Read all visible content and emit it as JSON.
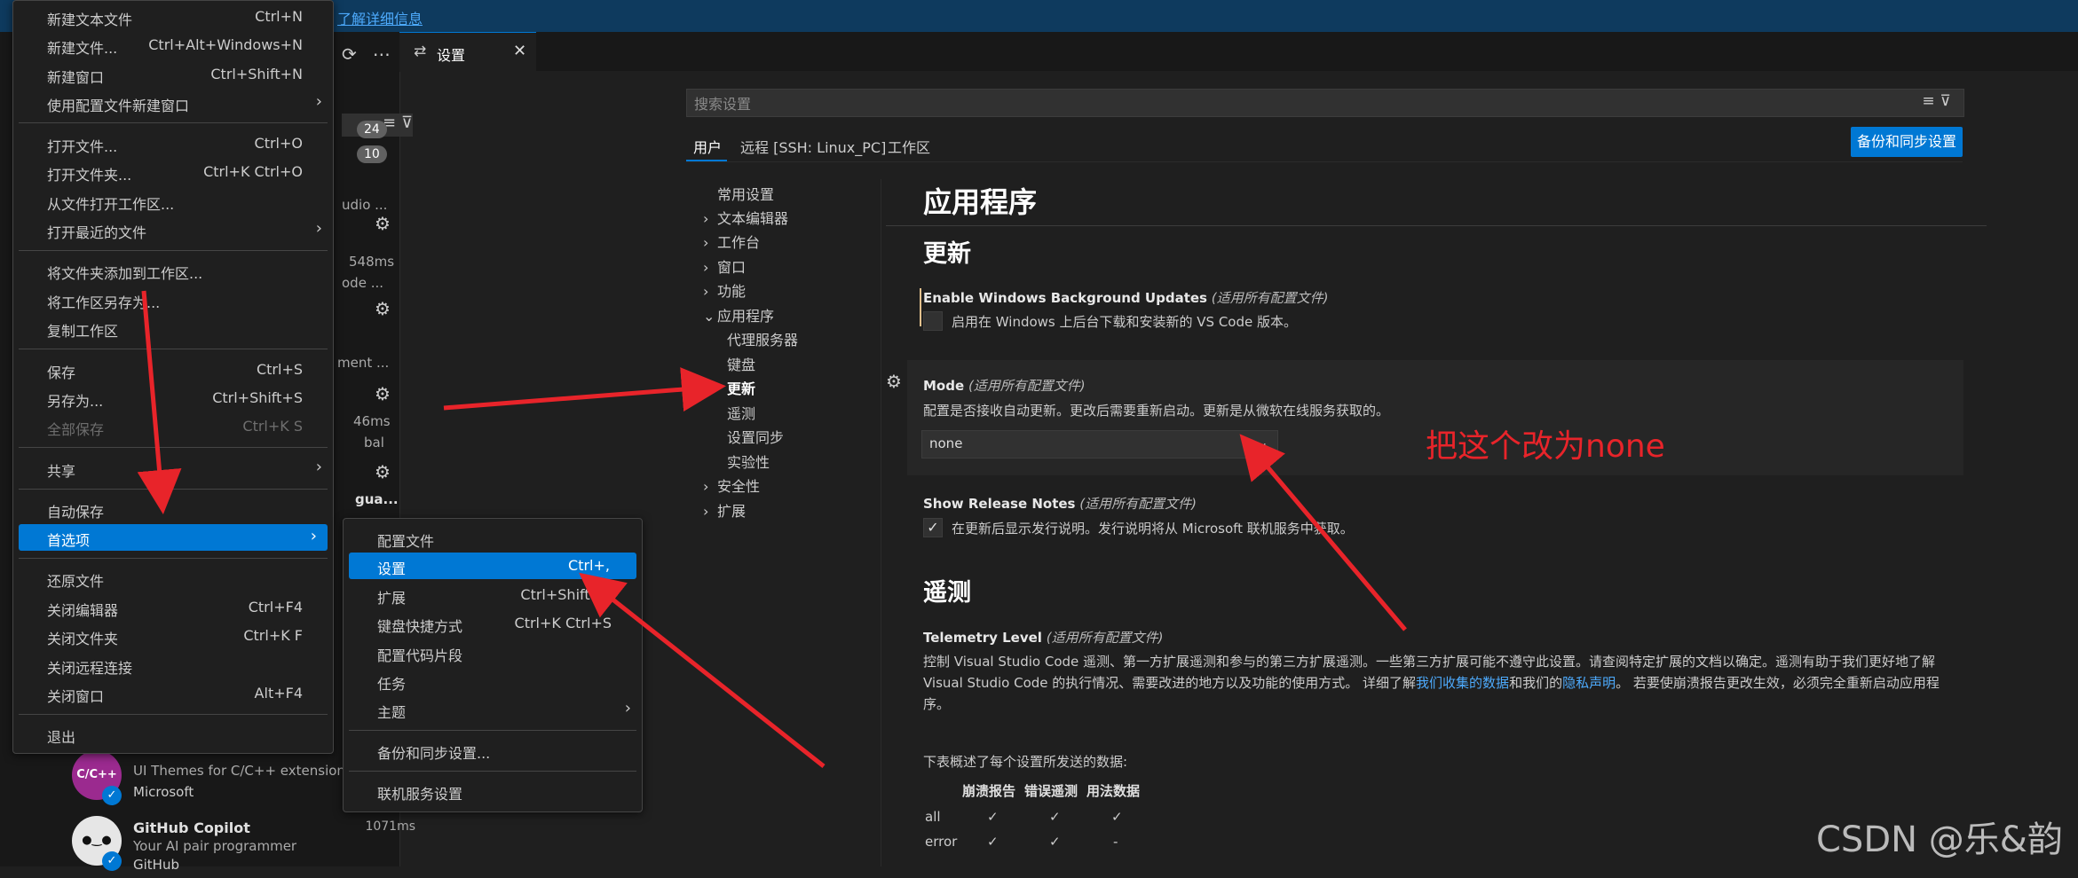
{
  "notice": {
    "link_text": "了解详细信息"
  },
  "tab": {
    "label": "设置"
  },
  "sidebar": {
    "badges": [
      "24",
      "10"
    ],
    "fragments": [
      "udio ...",
      "548ms",
      "ode ...",
      "ment ...",
      "46ms",
      "bal",
      "gua..."
    ],
    "extensions": [
      {
        "icon": "C/C++",
        "name": "",
        "desc": "UI Themes for C/C++ extension.",
        "publisher": "Microsoft",
        "time": ""
      },
      {
        "icon": "Copilot",
        "name": "GitHub Copilot",
        "desc": "Your AI pair programmer",
        "publisher": "GitHub",
        "time": "1071ms",
        "status": "已启用"
      }
    ]
  },
  "settings": {
    "search_placeholder": "搜索设置",
    "tabs": [
      "用户",
      "远程 [SSH: Linux_PC]",
      "工作区"
    ],
    "sync_button": "备份和同步设置",
    "toc": [
      {
        "label": "常用设置",
        "chevron": ""
      },
      {
        "label": "文本编辑器",
        "chevron": "›"
      },
      {
        "label": "工作台",
        "chevron": "›"
      },
      {
        "label": "窗口",
        "chevron": "›"
      },
      {
        "label": "功能",
        "chevron": "›"
      },
      {
        "label": "应用程序",
        "chevron": "⌄"
      },
      {
        "label": "代理服务器",
        "chevron": ""
      },
      {
        "label": "键盘",
        "chevron": ""
      },
      {
        "label": "更新",
        "chevron": ""
      },
      {
        "label": "遥测",
        "chevron": ""
      },
      {
        "label": "设置同步",
        "chevron": ""
      },
      {
        "label": "实验性",
        "chevron": ""
      },
      {
        "label": "安全性",
        "chevron": "›"
      },
      {
        "label": "扩展",
        "chevron": "›"
      }
    ],
    "h1": "应用程序",
    "section_update": "更新",
    "bg_updates": {
      "title": "Enable Windows Background Updates",
      "scope": "(适用所有配置文件)",
      "desc": "启用在 Windows 上后台下载和安装新的 VS Code 版本。",
      "checked": false
    },
    "mode": {
      "title": "Mode",
      "scope": "(适用所有配置文件)",
      "desc": "配置是否接收自动更新。更改后需要重新启动。更新是从微软在线服务获取的。",
      "value": "none"
    },
    "release_notes": {
      "title": "Show Release Notes",
      "scope": "(适用所有配置文件)",
      "desc": "在更新后显示发行说明。发行说明将从 Microsoft 联机服务中获取。",
      "checked": true
    },
    "section_telemetry": "遥测",
    "telemetry": {
      "title": "Telemetry Level",
      "scope": "(适用所有配置文件)",
      "desc1": "控制 Visual Studio Code 遥测、第一方扩展遥测和参与的第三方扩展遥测。一些第三方扩展可能不遵守此设置。请查阅特定扩展的文档以确定。遥测有助于我们更好地了解 Visual Studio Code 的执行情况、需要改进的地方以及功能的使用方式。 详细了解",
      "link1": "我们收集的数据",
      "mid": "和我们的",
      "link2": "隐私声明",
      "desc2": "。 若要使崩溃报告更改生效，必须完全重新启动应用程序。",
      "table_intro": "下表概述了每个设置所发送的数据:",
      "table_headers": [
        "崩溃报告",
        "错误遥测",
        "用法数据"
      ],
      "table_rows": [
        {
          "level": "all",
          "cells": [
            "✓",
            "✓",
            "✓"
          ]
        },
        {
          "level": "error",
          "cells": [
            "✓",
            "✓",
            "-"
          ]
        }
      ]
    }
  },
  "annotation": "把这个改为none",
  "watermark": "CSDN @乐&韵",
  "file_menu": [
    {
      "label": "新建文本文件",
      "key": "Ctrl+N"
    },
    {
      "label": "新建文件...",
      "key": "Ctrl+Alt+Windows+N"
    },
    {
      "label": "新建窗口",
      "key": "Ctrl+Shift+N"
    },
    {
      "label": "使用配置文件新建窗口",
      "key": ""
    },
    {
      "label": "打开文件...",
      "key": "Ctrl+O"
    },
    {
      "label": "打开文件夹...",
      "key": "Ctrl+K Ctrl+O"
    },
    {
      "label": "从文件打开工作区...",
      "key": ""
    },
    {
      "label": "打开最近的文件",
      "key": ""
    },
    {
      "label": "将文件夹添加到工作区...",
      "key": ""
    },
    {
      "label": "将工作区另存为...",
      "key": ""
    },
    {
      "label": "复制工作区",
      "key": ""
    },
    {
      "label": "保存",
      "key": "Ctrl+S"
    },
    {
      "label": "另存为...",
      "key": "Ctrl+Shift+S"
    },
    {
      "label": "全部保存",
      "key": "Ctrl+K S"
    },
    {
      "label": "共享",
      "key": ""
    },
    {
      "label": "自动保存",
      "key": ""
    },
    {
      "label": "首选项",
      "key": ""
    },
    {
      "label": "还原文件",
      "key": ""
    },
    {
      "label": "关闭编辑器",
      "key": "Ctrl+F4"
    },
    {
      "label": "关闭文件夹",
      "key": "Ctrl+K F"
    },
    {
      "label": "关闭远程连接",
      "key": ""
    },
    {
      "label": "关闭窗口",
      "key": "Alt+F4"
    },
    {
      "label": "退出",
      "key": ""
    }
  ],
  "pref_menu": [
    {
      "label": "配置文件",
      "key": ""
    },
    {
      "label": "设置",
      "key": "Ctrl+,"
    },
    {
      "label": "扩展",
      "key": "Ctrl+Shift+X"
    },
    {
      "label": "键盘快捷方式",
      "key": "Ctrl+K Ctrl+S"
    },
    {
      "label": "配置代码片段",
      "key": ""
    },
    {
      "label": "任务",
      "key": ""
    },
    {
      "label": "主题",
      "key": ""
    },
    {
      "label": "备份和同步设置...",
      "key": ""
    },
    {
      "label": "联机服务设置",
      "key": ""
    }
  ],
  "colors": {
    "accent": "#0078d4",
    "annotation": "#e8242a",
    "arrow": "#e8242a"
  }
}
